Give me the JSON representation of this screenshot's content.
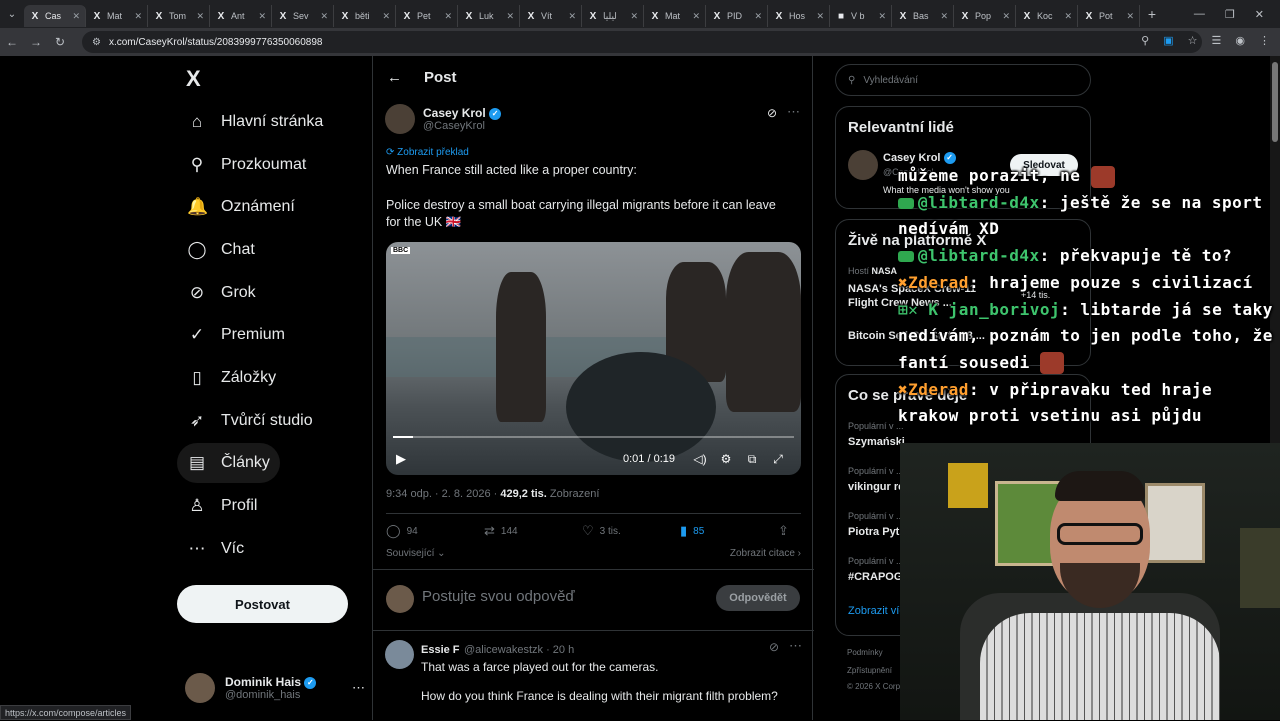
{
  "browser": {
    "tabs": [
      {
        "label": "Cas",
        "icon": "X",
        "active": true
      },
      {
        "label": "Mat",
        "icon": "X"
      },
      {
        "label": "Tom",
        "icon": "X"
      },
      {
        "label": "Ant",
        "icon": "X"
      },
      {
        "label": "Sev",
        "icon": "X"
      },
      {
        "label": "běti",
        "icon": "X"
      },
      {
        "label": "Pet",
        "icon": "X"
      },
      {
        "label": "Luk",
        "icon": "X"
      },
      {
        "label": "Vít",
        "icon": "X"
      },
      {
        "label": "ليليا",
        "icon": "X"
      },
      {
        "label": "Mat",
        "icon": "X"
      },
      {
        "label": "PID",
        "icon": "X"
      },
      {
        "label": "Hos",
        "icon": "X"
      },
      {
        "label": "V b",
        "icon": "■"
      },
      {
        "label": "Bas",
        "icon": "X"
      },
      {
        "label": "Pop",
        "icon": "X"
      },
      {
        "label": "Koc",
        "icon": "X"
      },
      {
        "label": "Pot",
        "icon": "X"
      }
    ],
    "url": "x.com/CaseyKrol/status/2083999776350060898",
    "status_url": "https://x.com/compose/articles"
  },
  "nav": {
    "logo": "X",
    "items": [
      {
        "label": "Hlavní stránka",
        "icon": "home-icon",
        "glyph": "⌂"
      },
      {
        "label": "Prozkoumat",
        "icon": "search-icon",
        "glyph": "⚲"
      },
      {
        "label": "Oznámení",
        "icon": "bell-icon",
        "glyph": "🔔"
      },
      {
        "label": "Chat",
        "icon": "chat-icon",
        "glyph": "◯"
      },
      {
        "label": "Grok",
        "icon": "grok-icon",
        "glyph": "⊘"
      },
      {
        "label": "Premium",
        "icon": "premium-icon",
        "glyph": "✓"
      },
      {
        "label": "Záložky",
        "icon": "bookmark-icon",
        "glyph": "▯"
      },
      {
        "label": "Tvůrčí studio",
        "icon": "rocket-icon",
        "glyph": "➶"
      },
      {
        "label": "Články",
        "icon": "article-icon",
        "glyph": "▤"
      },
      {
        "label": "Profil",
        "icon": "profile-icon",
        "glyph": "♙"
      },
      {
        "label": "Víc",
        "icon": "more-icon",
        "glyph": "⋯"
      }
    ],
    "post_button": "Postovat",
    "account": {
      "name": "Dominik Hais",
      "handle": "@dominik_hais"
    }
  },
  "post": {
    "header": "Post",
    "author_name": "Casey Krol",
    "author_handle": "@CaseyKrol",
    "translate": "Zobrazit překlad",
    "text_line1": "When France still acted like a proper country:",
    "text_line2": "Police destroy a small boat carrying illegal migrants before it can leave",
    "text_line3": "for the UK 🇬🇧",
    "video": {
      "source_mark": "BBC",
      "time": "0:01 / 0:19",
      "progress": 0.05
    },
    "time_date": "9:34 odp. · 2. 8. 2026 ·",
    "views": "429,2 tis.",
    "views_label": "Zobrazení",
    "replies": "94",
    "reposts": "144",
    "likes": "3 tis.",
    "bookmarks": "85",
    "related": "Související",
    "quotes": "Zobrazit citace",
    "reply_placeholder": "Postujte svou odpověď",
    "reply_button": "Odpovědět"
  },
  "reply": {
    "name": "Essie F",
    "handle": "@alicewakestzk · 20 h",
    "line1": "That was a farce played out for the cameras.",
    "line2": "How do you think France is dealing with their migrant filth problem?"
  },
  "sidebar": {
    "search_placeholder": "Vyhledávání",
    "relevant_title": "Relevantní lidé",
    "person_name": "Casey Krol",
    "person_handle": "@CaseyKrol",
    "person_bio": "What the media won't show you",
    "follow": "Sledovat",
    "live_title": "Živě na platformě X",
    "live_host": "Hostí",
    "live_host_name": "NASA",
    "live_title1": "NASA's SpaceX Crew-11",
    "live_title1b": "Flight Crew News ...",
    "live_count": "+14 tis.",
    "live_title2": "Bitcoin Sell-Off Stats 28 ...",
    "whats_title": "Co se právě děje",
    "trends": [
      {
        "label": "Populární v ...",
        "title": "Szymański"
      },
      {
        "label": "Populární v ...",
        "title": "vikingur re..."
      },
      {
        "label": "Populární v ...",
        "title": "Piotra Pyth..."
      },
      {
        "label": "Populární v ...",
        "title": "#CRAPOG..."
      }
    ],
    "show_more": "Zobrazit víc",
    "footer1": "Podmínky",
    "footer2": "Zpřístupnění",
    "footer3": "© 2026 X Corp."
  },
  "chat": {
    "line0_tail": "můžeme porazit, ne",
    "m1_user": "@libtard-d4x",
    "m1_text": ": ještě že se na sport nedívám XD",
    "m2_user": "@libtard-d4x",
    "m2_text": ": překvapuje tě to?",
    "m3_user": "Zderad",
    "m3_text": ": hrajeme pouze s civilizací",
    "m4_user": "jan_borivoj",
    "m4_text": ": libtarde já se taky nedívám, poznám to jen podle toho, že fantí sousedi",
    "m5_user": "Zderad",
    "m5_text": ": v připravaku ted hraje krakow proti vsetinu asi půjdu"
  }
}
